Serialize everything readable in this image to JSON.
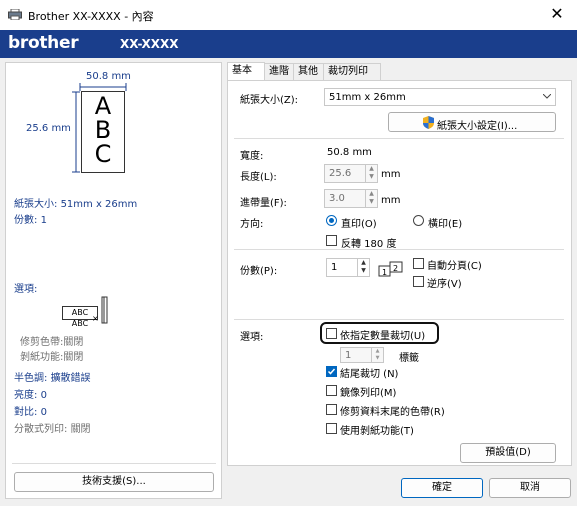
{
  "window": {
    "title": "Brother XX-XXXX - 內容",
    "close_glyph": "✕"
  },
  "brand": {
    "logo": "brother",
    "model": "XX-XXXX"
  },
  "preview": {
    "width_label": "50.8 mm",
    "height_label": "25.6 mm",
    "letters": [
      "A",
      "B",
      "C"
    ],
    "paper_size_label": "紙張大小:",
    "paper_size_value": "51mm x 26mm",
    "copies_label": "份數:",
    "copies_value": "1",
    "options_label": "選項:",
    "option_sample": "ABC ABC",
    "cut_color_label": "修剪色帶:",
    "cut_color_value": "關閉",
    "peel_label": "剝紙功能:",
    "peel_value": "關閉",
    "halftone_label": "半色調:",
    "halftone_value": "擴散錯誤",
    "brightness_label": "亮度:",
    "brightness_value": "0",
    "contrast_label": "對比:",
    "contrast_value": "0",
    "split_label": "分散式列印:",
    "split_value": "關閉",
    "support_button": "技術支援(S)..."
  },
  "tabs": [
    "基本",
    "進階",
    "其他",
    "裁切列印"
  ],
  "basic": {
    "paper_size_label": "紙張大小(Z):",
    "paper_size_value": "51mm x 26mm",
    "paper_size_button": "紙張大小設定(I)...",
    "width_label": "寬度:",
    "width_value": "50.8 mm",
    "length_label": "長度(L):",
    "length_value": "25.6",
    "length_unit": "mm",
    "feed_label": "進帶量(F):",
    "feed_value": "3.0",
    "feed_unit": "mm",
    "orientation_label": "方向:",
    "portrait": "直印(O)",
    "landscape": "橫印(E)",
    "rotate": "反轉 180 度",
    "copies_label": "份數(P):",
    "copies_value": "1",
    "collate": "自動分頁(C)",
    "reverse": "逆序(V)",
    "options_label": "選項:",
    "cut_every": "依指定數量裁切(U)",
    "cut_every_value": "1",
    "cut_every_unit": "標籤",
    "cut_at_end": "結尾裁切 (N)",
    "mirror": "鏡像列印(M)",
    "trim_tape": "修剪資料末尾的色帶(R)",
    "peel": "使用剝紙功能(T)",
    "default_button": "預設值(D)"
  },
  "footer": {
    "ok": "確定",
    "cancel": "取消"
  },
  "colors": {
    "brand_blue": "#1a3e8c",
    "accent": "#0067c0"
  }
}
